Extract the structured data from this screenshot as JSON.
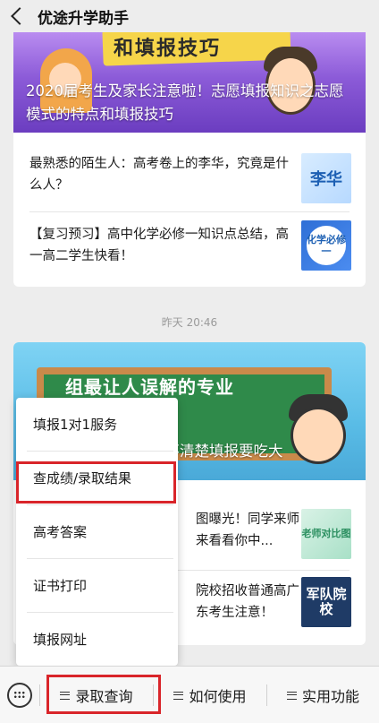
{
  "header": {
    "title": "优途升学助手",
    "back_icon": "chevron-left-icon"
  },
  "article1": {
    "banner_text": "和填报技巧",
    "title": "2020届考生及家长注意啦！志愿填报知识之志愿模式的特点和填报技巧"
  },
  "article_list1": [
    {
      "text": "最熟悉的陌生人：高考卷上的李华，究竟是什么人？",
      "thumb_text": "李华"
    },
    {
      "text": "【复习预习】高中化学必修一知识点总结，高一高二学生快看！",
      "thumb_text": "化学必修一"
    }
  ],
  "timestamp": "昨天 20:46",
  "article2": {
    "board_text": "组最让人误解的专业",
    "title_pre": "专",
    "title": "业！搞不清楚填报要吃大"
  },
  "article_list2": [
    {
      "text": "图曝光！同学来师来看看你中...",
      "thumb_text": "老师对比图"
    },
    {
      "text": "院校招收普通高广东考生注意！",
      "thumb_text": "军队院校"
    }
  ],
  "popup_menu": {
    "items": [
      "填报1对1服务",
      "查成绩/录取结果",
      "高考答案",
      "证书打印",
      "填报网址"
    ],
    "highlighted_index": 1
  },
  "bottom_bar": {
    "keyboard_icon": "keyboard-icon",
    "menus": [
      "录取查询",
      "如何使用",
      "实用功能"
    ],
    "highlighted_index": 0
  },
  "colors": {
    "highlight": "#d9252a",
    "background": "#ededed"
  }
}
